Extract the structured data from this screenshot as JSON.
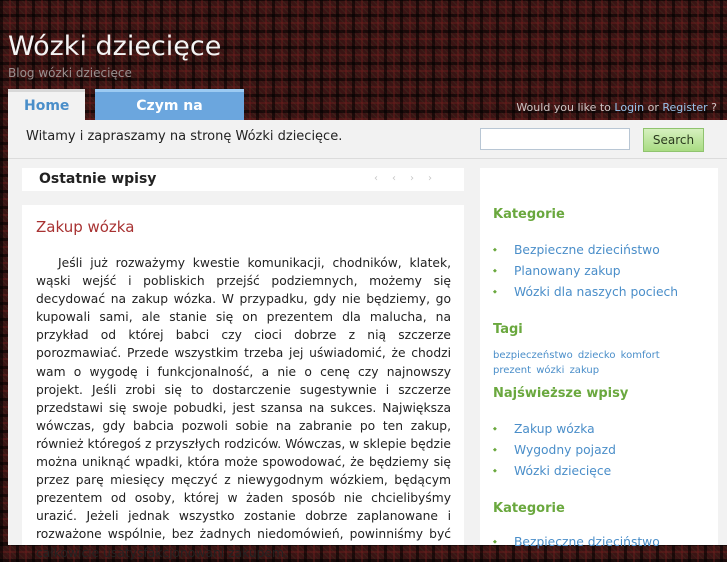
{
  "site": {
    "title": "Wózki dziecięce",
    "description": "Blog wózki dziecięce"
  },
  "nav": {
    "tabs": [
      {
        "label": "Home"
      },
      {
        "label": "Czym na spacer"
      }
    ],
    "login_prefix": "Would you like to",
    "login_link": "Login",
    "login_or": "or",
    "register_link": "Register",
    "login_suffix": "?"
  },
  "header": {
    "welcome": "Witamy i zapraszamy na stronę Wózki dziecięce.",
    "search_placeholder": "",
    "search_button": "Search"
  },
  "recent": {
    "title": "Ostatnie wpisy",
    "prev": "‹‹",
    "next": "››"
  },
  "post": {
    "title": "Zakup wózka",
    "body": "Jeśli już rozważymy kwestie komunikacji, chodników, klatek, wąski wejść i pobliskich przejść podziemnych, możemy się decydować na zakup wózka. W przypadku, gdy nie będziemy, go kupowali sami, ale stanie się on prezentem dla malucha, na przykład od której babci czy cioci dobrze z nią szczerze porozmawiać. Przede wszystkim trzeba jej uświadomić, że chodzi wam o wygodę i funkcjonalność, a nie o cenę czy najnowszy projekt. Jeśli zrobi się to dostarczenie sugestywnie i szczerze przedstawi się swoje pobudki, jest szansa na sukces. Największa wówczas, gdy babcia pozwoli sobie na zabranie po ten zakup, również któregoś z przyszłych rodziców. Wówczas, w sklepie będzie można uniknąć wpadki, która może spowodować, że będziemy się przez parę miesięcy męczyć z niewygodnym wózkiem, będącym prezentem od osoby, której w żaden sposób nie chcielibyśmy urazić. Jeżeli jednak wszystko zostanie dobrze zaplanowane i rozważone wspólnie, bez żadnych niedomówień, powinniśmy być całkowicie usatysfakcjonowani zakupem."
  },
  "sidebar": {
    "categories_title": "Kategorie",
    "categories": [
      "Bezpieczne dzieciństwo",
      "Planowany zakup",
      "Wózki dla naszych pociech"
    ],
    "tags_title": "Tagi",
    "tags": [
      "bezpieczeństwo",
      "dziecko",
      "komfort",
      "prezent",
      "wózki",
      "zakup"
    ],
    "newest_title": "Najświeższe wpisy",
    "newest": [
      "Zakup wózka",
      "Wygodny pojazd",
      "Wózki dziecięce"
    ],
    "categories2_title": "Kategorie",
    "categories2": [
      "Bezpieczne dzieciństwo"
    ]
  }
}
